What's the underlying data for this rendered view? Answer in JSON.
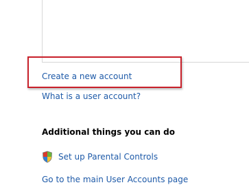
{
  "links": {
    "create_account": "Create a new account",
    "what_is_user_account": "What is a user account?",
    "main_user_accounts_page": "Go to the main User Accounts page"
  },
  "additional": {
    "heading": "Additional things you can do",
    "parental_controls": "Set up Parental Controls",
    "parental_controls_icon": "windows-security-shield-icon"
  },
  "colors": {
    "link": "#1e5aa8",
    "highlight_box": "#c8202a",
    "heading": "#000000"
  }
}
